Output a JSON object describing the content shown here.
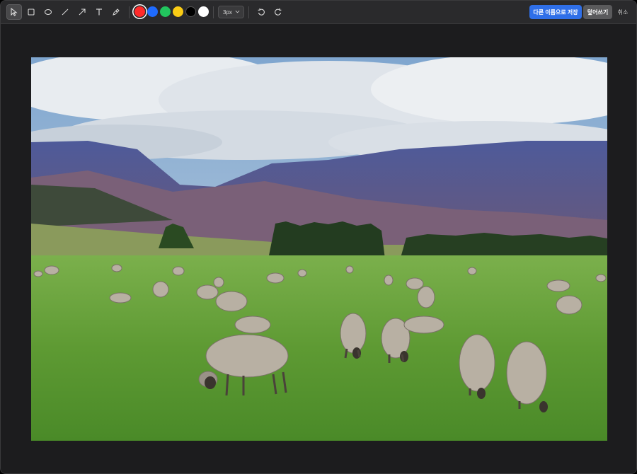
{
  "toolbar": {
    "tools": [
      {
        "name": "select",
        "icon": "cursor-arrow-icon",
        "active": true
      },
      {
        "name": "rectangle",
        "icon": "rectangle-icon",
        "active": false
      },
      {
        "name": "ellipse",
        "icon": "ellipse-icon",
        "active": false
      },
      {
        "name": "line",
        "icon": "line-icon",
        "active": false
      },
      {
        "name": "arrow",
        "icon": "arrow-icon",
        "active": false
      },
      {
        "name": "text",
        "icon": "text-icon",
        "active": false
      },
      {
        "name": "pen",
        "icon": "pen-icon",
        "active": false
      }
    ],
    "colors": [
      "#ff2a2a",
      "#1f6bff",
      "#22c55e",
      "#facc15",
      "#000000",
      "#ffffff"
    ],
    "selected_color": "#ff2a2a",
    "stroke_width": "3px",
    "undo_icon": "undo-icon",
    "redo_icon": "redo-icon",
    "save_as_label": "다른 이름으로 저장",
    "overwrite_label": "덮어쓰기",
    "cancel_label": "취소",
    "accent": "#2f6fe8"
  },
  "canvas": {
    "image_description_icon": "photo-image"
  }
}
